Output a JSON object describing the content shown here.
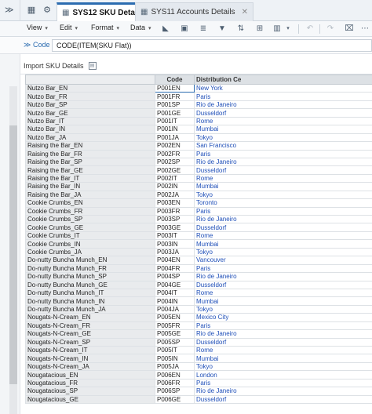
{
  "tabs": [
    {
      "label": "SYS12 SKU Details",
      "active": true
    },
    {
      "label": "SYS11 Accounts Details",
      "active": false
    }
  ],
  "toolbar": {
    "menus": [
      "View",
      "Edit",
      "Format",
      "Data"
    ]
  },
  "formula": {
    "label": "Code",
    "value": "CODE(ITEM(SKU Flat))"
  },
  "panel": {
    "title": "Import SKU Details"
  },
  "grid": {
    "columns": [
      "Code",
      "Distribution Ce"
    ],
    "rows": [
      {
        "name": "Nutzo Bar_EN",
        "code": "P001EN",
        "dist": "New York"
      },
      {
        "name": "Nutzo Bar_FR",
        "code": "P001FR",
        "dist": "Paris"
      },
      {
        "name": "Nutzo Bar_SP",
        "code": "P001SP",
        "dist": "Rio de Janeiro"
      },
      {
        "name": "Nutzo Bar_GE",
        "code": "P001GE",
        "dist": "Dusseldorf"
      },
      {
        "name": "Nutzo Bar_IT",
        "code": "P001IT",
        "dist": "Rome"
      },
      {
        "name": "Nutzo Bar_IN",
        "code": "P001IN",
        "dist": "Mumbai"
      },
      {
        "name": "Nutzo Bar_JA",
        "code": "P001JA",
        "dist": "Tokyo"
      },
      {
        "name": "Raising the Bar_EN",
        "code": "P002EN",
        "dist": "San Francisco"
      },
      {
        "name": "Raising the Bar_FR",
        "code": "P002FR",
        "dist": "Paris"
      },
      {
        "name": "Raising the Bar_SP",
        "code": "P002SP",
        "dist": "Rio de Janeiro"
      },
      {
        "name": "Raising the Bar_GE",
        "code": "P002GE",
        "dist": "Dusseldorf"
      },
      {
        "name": "Raising the Bar_IT",
        "code": "P002IT",
        "dist": "Rome"
      },
      {
        "name": "Raising the Bar_IN",
        "code": "P002IN",
        "dist": "Mumbai"
      },
      {
        "name": "Raising the Bar_JA",
        "code": "P002JA",
        "dist": "Tokyo"
      },
      {
        "name": "Cookie Crumbs_EN",
        "code": "P003EN",
        "dist": "Toronto"
      },
      {
        "name": "Cookie Crumbs_FR",
        "code": "P003FR",
        "dist": "Paris"
      },
      {
        "name": "Cookie Crumbs_SP",
        "code": "P003SP",
        "dist": "Rio de Janeiro"
      },
      {
        "name": "Cookie Crumbs_GE",
        "code": "P003GE",
        "dist": "Dusseldorf"
      },
      {
        "name": "Cookie Crumbs_IT",
        "code": "P003IT",
        "dist": "Rome"
      },
      {
        "name": "Cookie Crumbs_IN",
        "code": "P003IN",
        "dist": "Mumbai"
      },
      {
        "name": "Cookie Crumbs_JA",
        "code": "P003JA",
        "dist": "Tokyo"
      },
      {
        "name": "Do-nutty Buncha Munch_EN",
        "code": "P004EN",
        "dist": "Vancouver"
      },
      {
        "name": "Do-nutty Buncha Munch_FR",
        "code": "P004FR",
        "dist": "Paris"
      },
      {
        "name": "Do-nutty Buncha Munch_SP",
        "code": "P004SP",
        "dist": "Rio de Janeiro"
      },
      {
        "name": "Do-nutty Buncha Munch_GE",
        "code": "P004GE",
        "dist": "Dusseldorf"
      },
      {
        "name": "Do-nutty Buncha Munch_IT",
        "code": "P004IT",
        "dist": "Rome"
      },
      {
        "name": "Do-nutty Buncha Munch_IN",
        "code": "P004IN",
        "dist": "Mumbai"
      },
      {
        "name": "Do-nutty Buncha Munch_JA",
        "code": "P004JA",
        "dist": "Tokyo"
      },
      {
        "name": "Nougats-N-Cream_EN",
        "code": "P005EN",
        "dist": "Mexico City"
      },
      {
        "name": "Nougats-N-Cream_FR",
        "code": "P005FR",
        "dist": "Paris"
      },
      {
        "name": "Nougats-N-Cream_GE",
        "code": "P005GE",
        "dist": "Rio de Janeiro"
      },
      {
        "name": "Nougats-N-Cream_SP",
        "code": "P005SP",
        "dist": "Dusseldorf"
      },
      {
        "name": "Nougats-N-Cream_IT",
        "code": "P005IT",
        "dist": "Rome"
      },
      {
        "name": "Nougats-N-Cream_IN",
        "code": "P005IN",
        "dist": "Mumbai"
      },
      {
        "name": "Nougats-N-Cream_JA",
        "code": "P005JA",
        "dist": "Tokyo"
      },
      {
        "name": "Nougatacious_EN",
        "code": "P006EN",
        "dist": "London"
      },
      {
        "name": "Nougatacious_FR",
        "code": "P006FR",
        "dist": "Paris"
      },
      {
        "name": "Nougatacious_SP",
        "code": "P006SP",
        "dist": "Rio de Janeiro"
      },
      {
        "name": "Nougatacious_GE",
        "code": "P006GE",
        "dist": "Dusseldorf"
      }
    ]
  },
  "colors": {
    "accent": "#2b6cb0",
    "link_text": "#1f4fb8",
    "row_header_bg": "#e9ebed"
  },
  "icons": {
    "gutter_toggle": "chevron-double-right-icon",
    "tab_tools": [
      "grid-menu-icon",
      "gear-icon"
    ],
    "toolbar_tools": [
      "pivot-icon",
      "freeze-icon",
      "align-icon",
      "filter-icon",
      "sort-icon",
      "insert-icon",
      "chart-icon",
      "undo-icon",
      "redo-icon",
      "format-icon"
    ]
  }
}
